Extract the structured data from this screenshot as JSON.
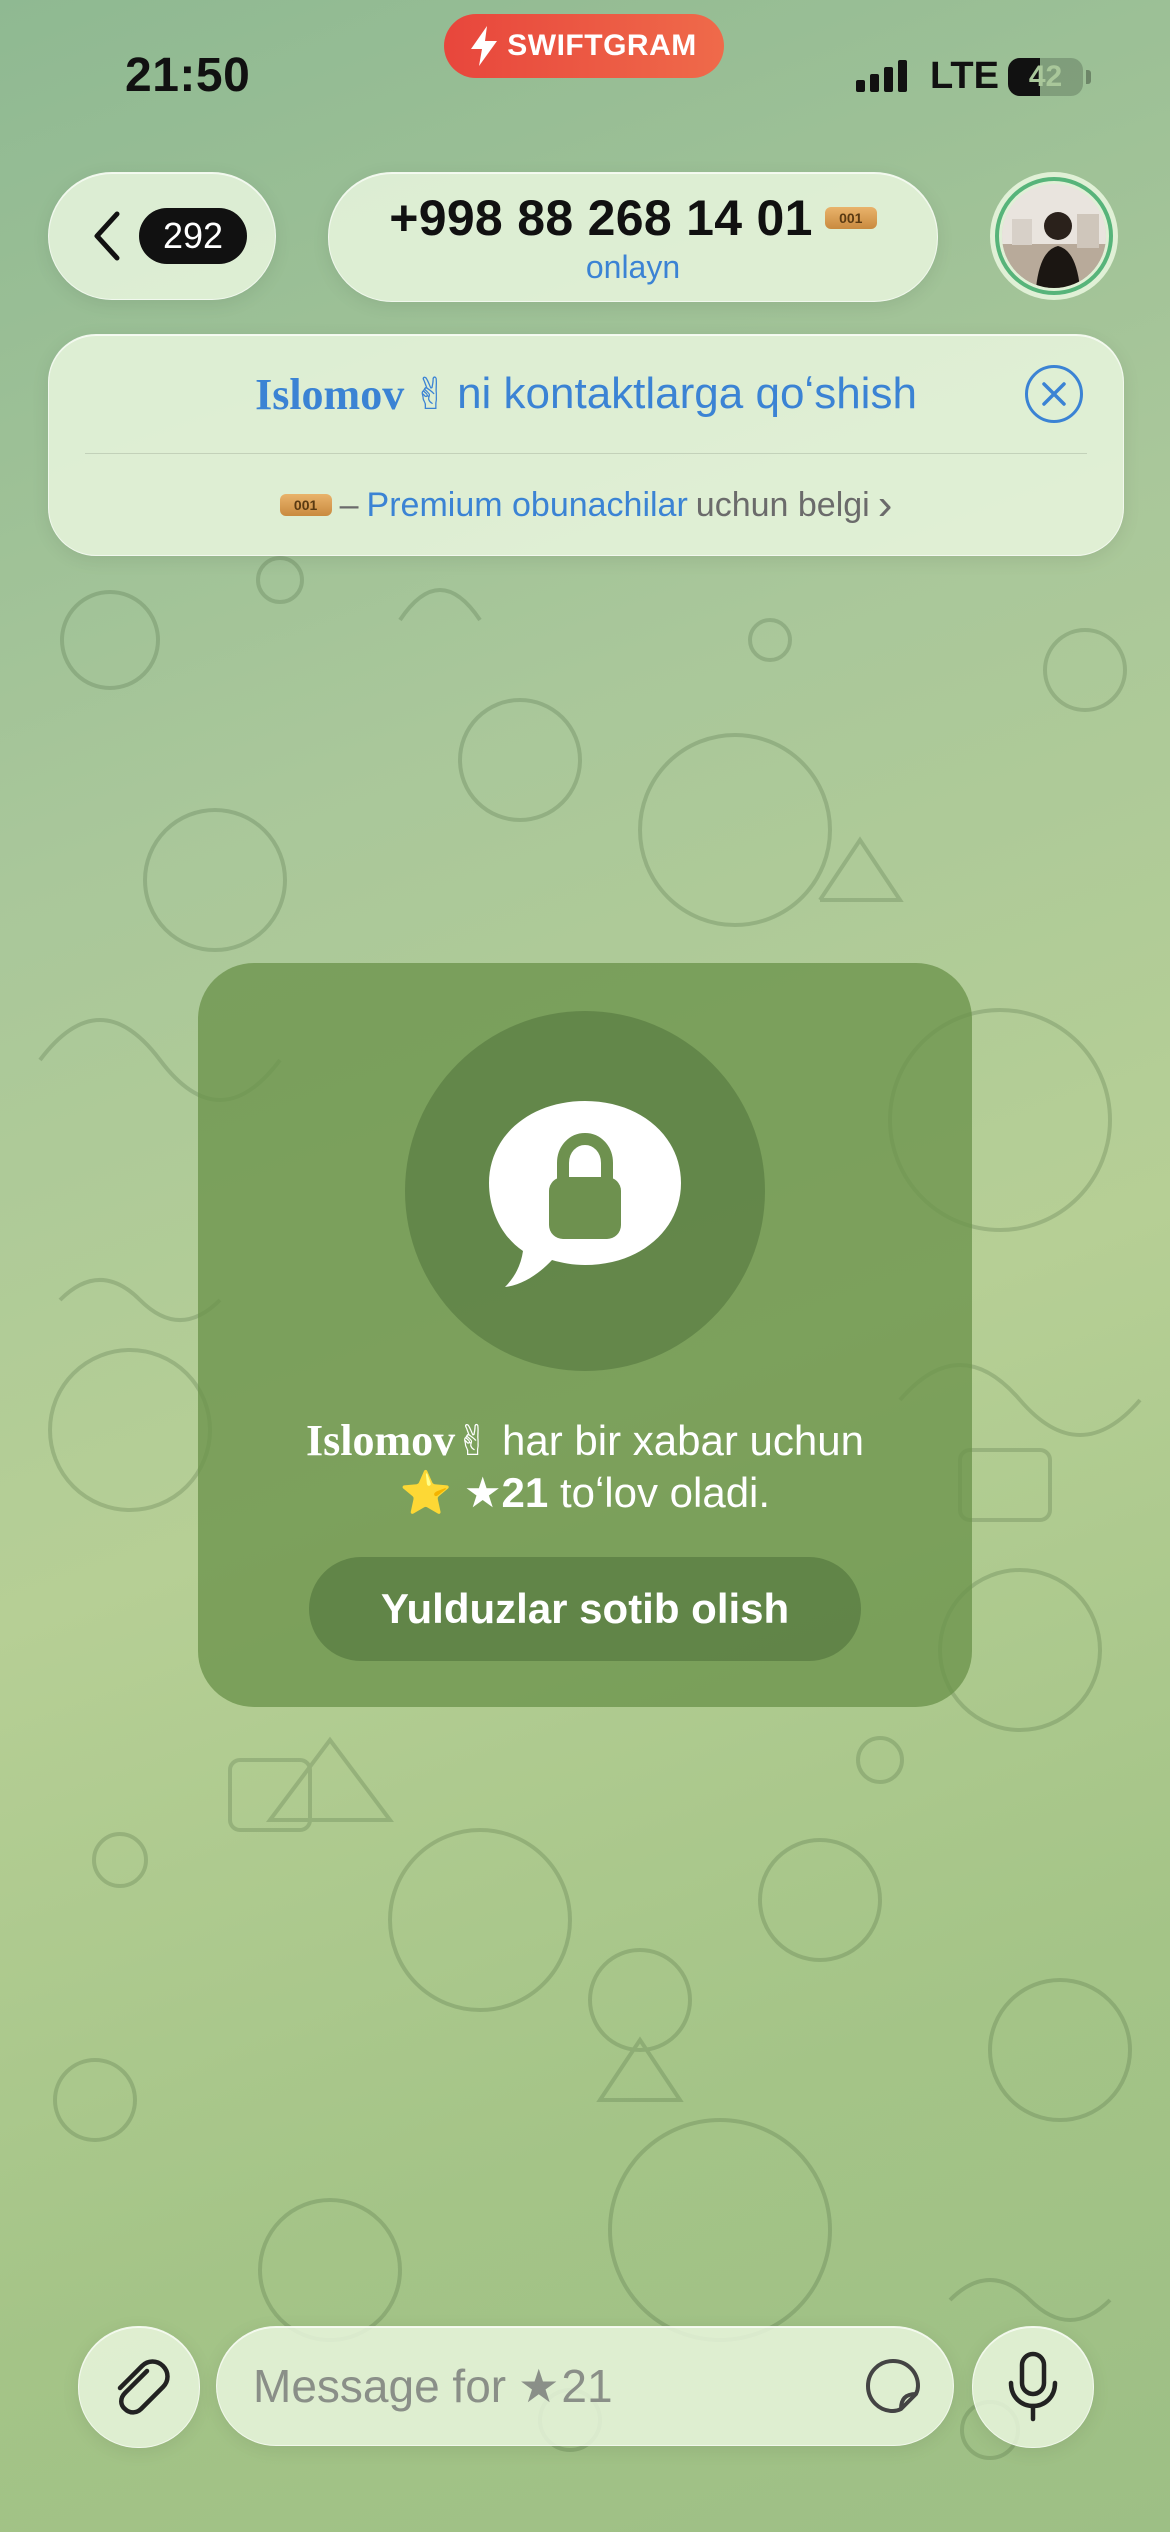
{
  "status_bar": {
    "time": "21:50",
    "app_badge": "SWIFTGRAM",
    "network": "LTE",
    "battery": "42",
    "battery_level": 0.42
  },
  "header": {
    "back_count": "292",
    "phone": "+998 88 268 14 01",
    "status": "onlayn",
    "badge_text": "001"
  },
  "banner": {
    "name": "Islomov",
    "name_emoji": "✌",
    "add_text": "ni kontaktlarga qoʻshish",
    "badge_text": "001",
    "dash": "–",
    "premium_link": "Premium obunachilar",
    "premium_suffix": "uchun belgi",
    "chevron": "›"
  },
  "card": {
    "name": "Islomov",
    "name_emoji": "✌",
    "line1_rest": "har bir xabar uchun",
    "star_emoji": "⭐",
    "star_icon": "★",
    "amount": "21",
    "line2_rest": "toʻlov oladi.",
    "button_label": "Yulduzlar sotib olish"
  },
  "composer": {
    "placeholder_prefix": "Message for",
    "star_icon": "★",
    "placeholder_amount": "21"
  },
  "colors": {
    "accent": "#3b83d4",
    "swift": "#e8463c",
    "card": "#6c944c"
  }
}
